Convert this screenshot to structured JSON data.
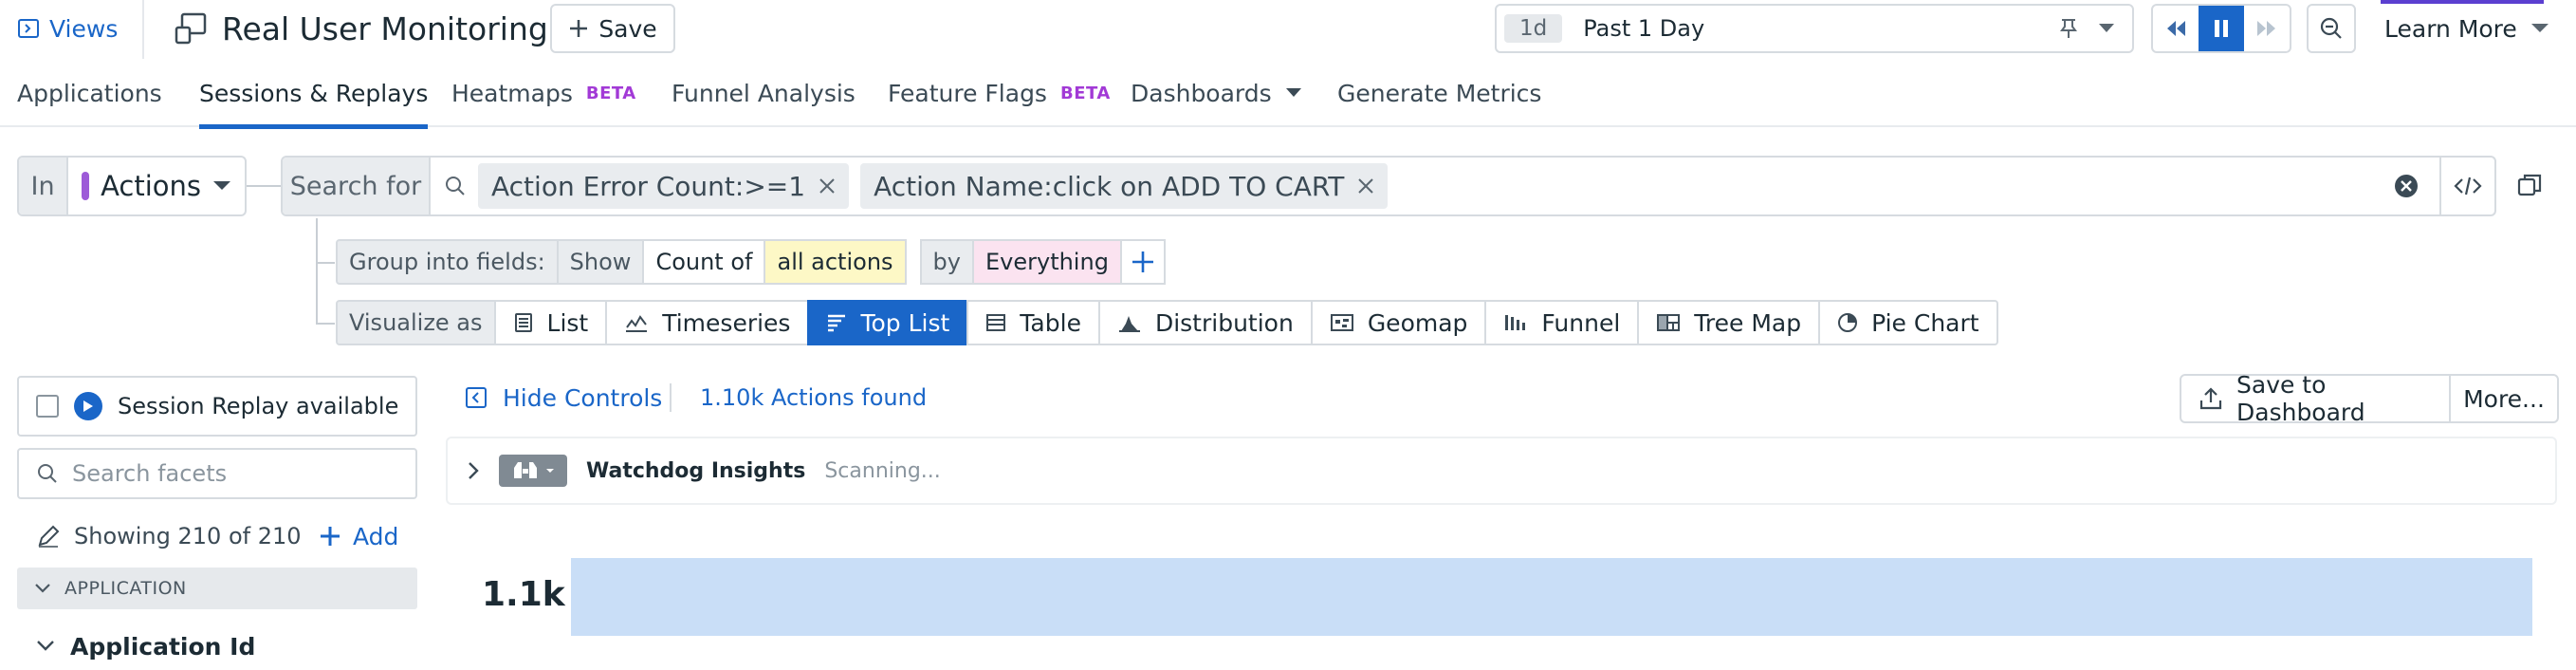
{
  "header": {
    "views_label": "Views",
    "title": "Real User Monitoring",
    "save_label": "Save",
    "time_chip": "1d",
    "time_value": "Past 1 Day",
    "learn_more": "Learn More"
  },
  "nav": {
    "tabs": [
      {
        "label": "Applications"
      },
      {
        "label": "Sessions & Replays",
        "active": true
      },
      {
        "label": "Heatmaps",
        "badge": "BETA"
      },
      {
        "label": "Funnel Analysis"
      },
      {
        "label": "Feature Flags",
        "badge": "BETA"
      },
      {
        "label": "Dashboards"
      },
      {
        "label": "Generate Metrics"
      }
    ]
  },
  "query": {
    "in_label": "In",
    "in_value": "Actions",
    "search_label": "Search for",
    "filters": [
      "Action Error Count:>=1",
      "Action Name:click on ADD TO CART"
    ],
    "group_label": "Group into fields:",
    "show_label": "Show",
    "count_of": "Count of",
    "measure": "all actions",
    "by_label": "by",
    "by_value": "Everything",
    "visualize_label": "Visualize as",
    "visualizations": [
      "List",
      "Timeseries",
      "Top List",
      "Table",
      "Distribution",
      "Geomap",
      "Funnel",
      "Tree Map",
      "Pie Chart"
    ],
    "active_visualization": "Top List"
  },
  "facets": {
    "session_replay": "Session Replay available",
    "search_placeholder": "Search facets",
    "showing": "Showing 210 of 210",
    "add_label": "Add",
    "group_header": "APPLICATION",
    "first_facet": "Application Id"
  },
  "results": {
    "hide_controls": "Hide Controls",
    "found": "1.10k Actions found",
    "save_to_dashboard": "Save to Dashboard",
    "more": "More...",
    "watchdog_title": "Watchdog Insights",
    "watchdog_status": "Scanning..."
  },
  "chart_data": {
    "type": "bar",
    "categories": [
      ""
    ],
    "values": [
      1100
    ],
    "value_labels": [
      "1.1k"
    ],
    "max": 1100
  },
  "colors": {
    "accent": "#1a66c8",
    "beta": "#a23ad6",
    "bar": "#c9def7"
  }
}
